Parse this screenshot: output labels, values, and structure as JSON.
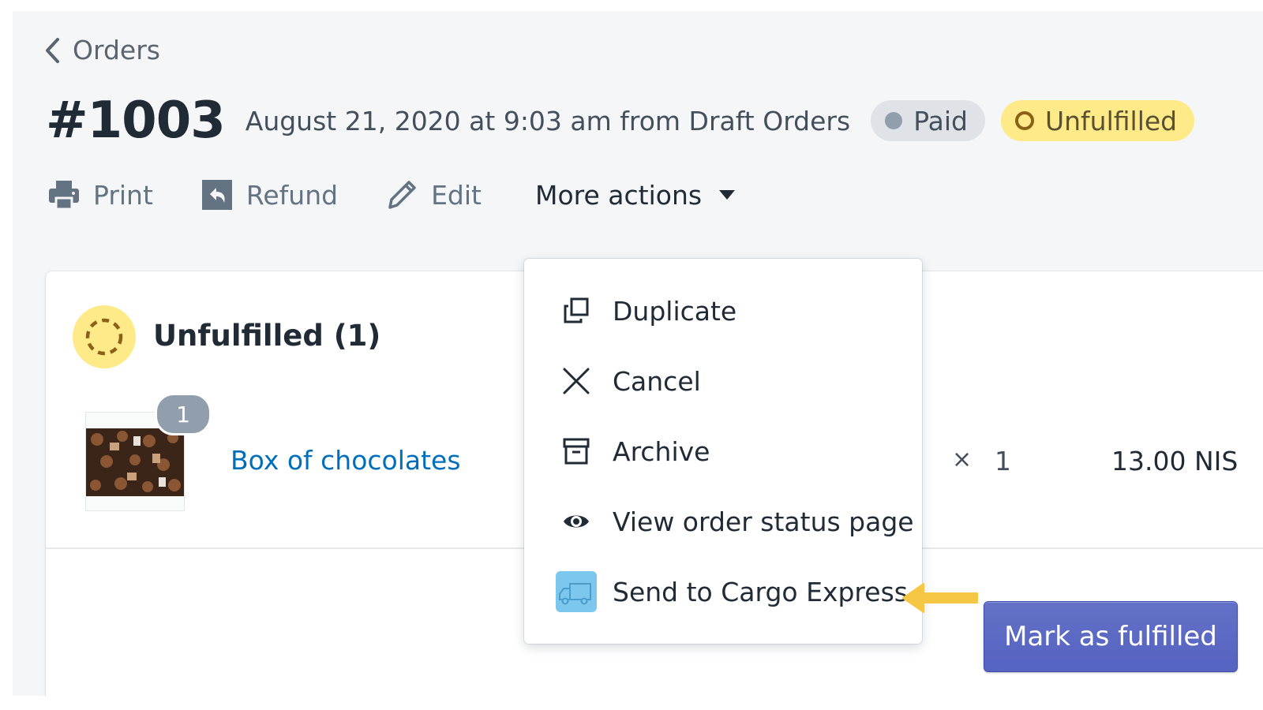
{
  "breadcrumb": {
    "label": "Orders"
  },
  "order": {
    "number": "#1003",
    "meta": "August 21, 2020 at 9:03 am from Draft Orders",
    "badges": {
      "paid": "Paid",
      "fulfillment": "Unfulfilled"
    }
  },
  "toolbar": {
    "print": "Print",
    "refund": "Refund",
    "edit": "Edit",
    "more_actions": "More actions"
  },
  "menu": {
    "items": [
      {
        "label": "Duplicate",
        "icon": "duplicate-icon"
      },
      {
        "label": "Cancel",
        "icon": "close-icon"
      },
      {
        "label": "Archive",
        "icon": "archive-icon"
      },
      {
        "label": "View order status page",
        "icon": "eye-icon"
      },
      {
        "label": "Send to Cargo Express",
        "icon": "truck-icon"
      }
    ]
  },
  "fulfillment_card": {
    "title": "Unfulfilled (1)",
    "line_item": {
      "quantity_badge": "1",
      "product": "Box of chocolates",
      "unit_price_visible": "IS",
      "times": "×",
      "quantity": "1",
      "total": "13.00 NIS"
    },
    "primary_action": "Mark as fulfilled"
  },
  "colors": {
    "page_background": "#f4f6f8",
    "unfulfilled_badge": "#ffea8a",
    "paid_badge": "#dfe3e8",
    "link": "#006fbb",
    "primary_button": "#5c6ac4",
    "annotation_arrow": "#f6c744"
  }
}
